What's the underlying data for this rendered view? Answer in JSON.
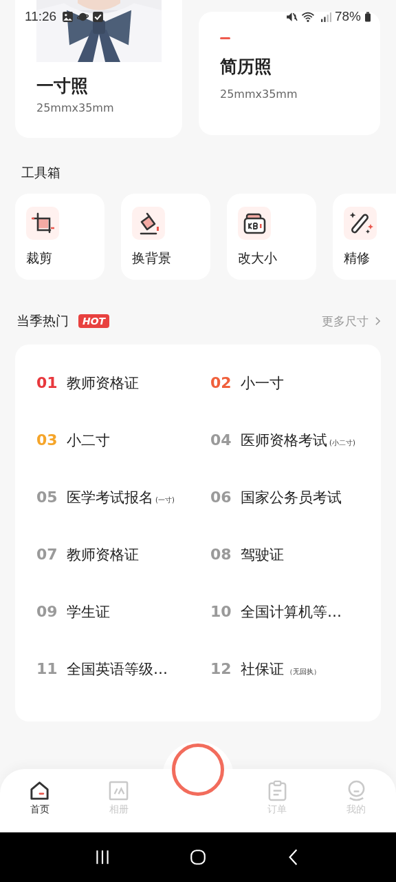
{
  "status_bar": {
    "time": "11:26",
    "battery": "78%"
  },
  "size_cards": [
    {
      "title": "一寸照",
      "size": "25mmx35mm"
    },
    {
      "title": "简历照",
      "size": "25mmx35mm",
      "kind": "plain"
    }
  ],
  "toolbox": {
    "title": "工具箱",
    "tools": [
      {
        "label": "裁剪",
        "kind": "crop"
      },
      {
        "label": "换背景",
        "kind": "bucket"
      },
      {
        "label": "改大小",
        "kind": "kb"
      },
      {
        "label": "精修",
        "kind": "wand"
      }
    ]
  },
  "hot": {
    "title": "当季热门",
    "badge": "HOT",
    "more": "更多尺寸",
    "items": [
      {
        "rank": "01",
        "name": "教师资格证",
        "color": "#e8383d"
      },
      {
        "rank": "02",
        "name": "小一寸",
        "color": "#f0603c"
      },
      {
        "rank": "03",
        "name": "小二寸",
        "color": "#f5a52a"
      },
      {
        "rank": "04",
        "name": "医师资格考试",
        "note": "(小二寸)",
        "color": "#9a9a9a"
      },
      {
        "rank": "05",
        "name": "医学考试报名",
        "note": "(一寸)",
        "color": "#9a9a9a"
      },
      {
        "rank": "06",
        "name": "国家公务员考试",
        "color": "#9a9a9a"
      },
      {
        "rank": "07",
        "name": "教师资格证",
        "color": "#9a9a9a"
      },
      {
        "rank": "08",
        "name": "驾驶证",
        "color": "#9a9a9a"
      },
      {
        "rank": "09",
        "name": "学生证",
        "color": "#9a9a9a"
      },
      {
        "rank": "10",
        "name": "全国计算机等…",
        "color": "#9a9a9a"
      },
      {
        "rank": "11",
        "name": "全国英语等级…",
        "color": "#9a9a9a"
      },
      {
        "rank": "12",
        "name": "社保证",
        "note": "（无回执）",
        "color": "#9a9a9a"
      }
    ]
  },
  "bottom_nav": [
    {
      "label": "首页",
      "kind": "home",
      "selected": true
    },
    {
      "label": "相册",
      "kind": "album",
      "selected": false
    },
    {
      "kind": "camera",
      "selected": false
    },
    {
      "label": "订单",
      "kind": "orders",
      "selected": false
    },
    {
      "label": "我的",
      "kind": "me",
      "selected": false
    }
  ]
}
